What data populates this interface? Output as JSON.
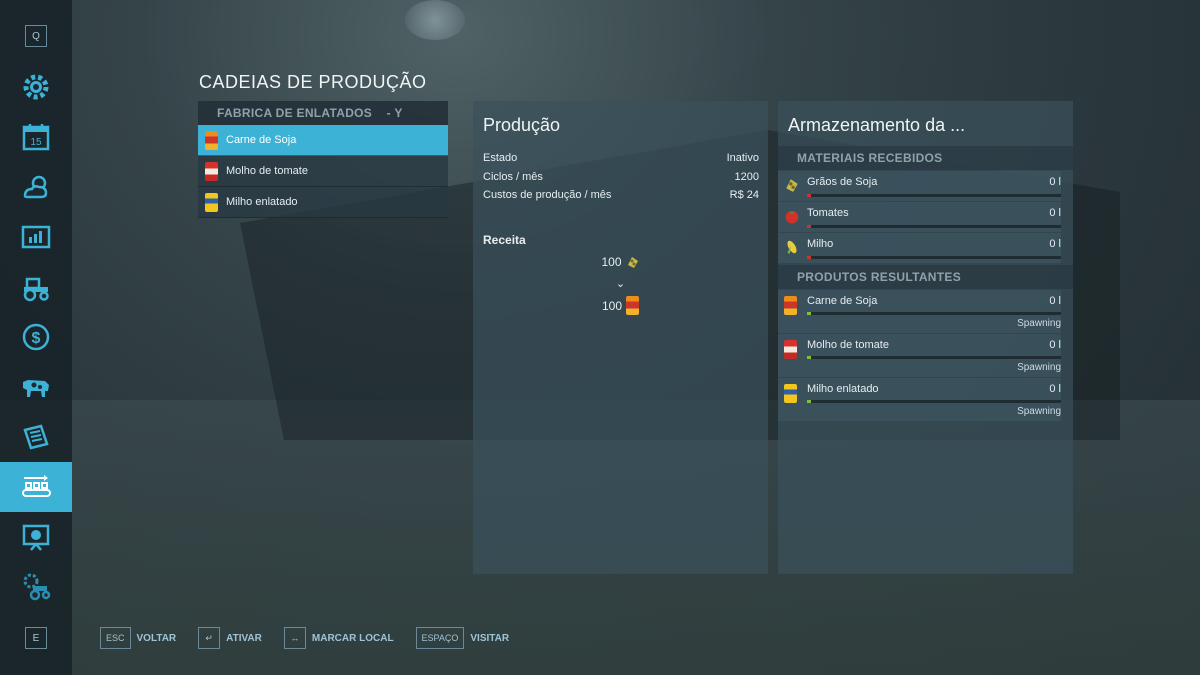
{
  "sidebar": {
    "top_key": "Q",
    "bottom_key": "E",
    "items": [
      {
        "icon": "gear-icon"
      },
      {
        "icon": "calendar-icon",
        "label": "15"
      },
      {
        "icon": "weather-icon"
      },
      {
        "icon": "chart-icon"
      },
      {
        "icon": "tractor-icon"
      },
      {
        "icon": "money-icon"
      },
      {
        "icon": "cow-icon"
      },
      {
        "icon": "contracts-icon"
      },
      {
        "icon": "production-icon",
        "active": true
      },
      {
        "icon": "help-icon"
      },
      {
        "icon": "settings-tractor-icon"
      }
    ]
  },
  "page_title": "CADEIAS DE PRODUÇÃO",
  "chains": {
    "header": "FABRICA DE ENLATADOS",
    "header_key": "- Y",
    "items": [
      {
        "label": "Carne de Soja",
        "icon": "soja-can-icon",
        "selected": true
      },
      {
        "label": "Molho de tomate",
        "icon": "tomato-can-icon",
        "selected": false
      },
      {
        "label": "Milho enlatado",
        "icon": "corn-can-icon",
        "selected": false
      }
    ]
  },
  "production": {
    "title": "Produção",
    "stats": [
      {
        "label": "Estado",
        "value": "Inativo"
      },
      {
        "label": "Ciclos / mês",
        "value": "1200"
      },
      {
        "label": "Custos de produção / mês",
        "value": "R$ 24"
      }
    ],
    "recipe_title": "Receita",
    "recipe_input_amount": "100",
    "recipe_arrow": "⌄",
    "recipe_output_amount": "100"
  },
  "storage": {
    "title": "Armazenamento da ...",
    "received_header": "MATERIAIS RECEBIDOS",
    "received": [
      {
        "name": "Grãos de Soja",
        "amount": "0 l",
        "icon": "soybean-icon"
      },
      {
        "name": "Tomates",
        "amount": "0 l",
        "icon": "tomato-icon"
      },
      {
        "name": "Milho",
        "amount": "0 l",
        "icon": "corn-icon"
      }
    ],
    "products_header": "PRODUTOS RESULTANTES",
    "products": [
      {
        "name": "Carne de Soja",
        "amount": "0 l",
        "mode": "Spawning",
        "icon": "soja-can-icon"
      },
      {
        "name": "Molho de tomate",
        "amount": "0 l",
        "mode": "Spawning",
        "icon": "tomato-can-icon"
      },
      {
        "name": "Milho enlatado",
        "amount": "0 l",
        "mode": "Spawning",
        "icon": "corn-can-icon"
      }
    ],
    "colors": {
      "empty_input": "#d0322a",
      "output": "#7fc23a"
    }
  },
  "footer": {
    "hints": [
      {
        "key": "ESC",
        "label": "VOLTAR"
      },
      {
        "key": "↵",
        "label": "ATIVAR"
      },
      {
        "key": "↔",
        "label": "MARCAR LOCAL"
      },
      {
        "key": "ESPAÇO",
        "label": "VISITAR"
      }
    ]
  }
}
